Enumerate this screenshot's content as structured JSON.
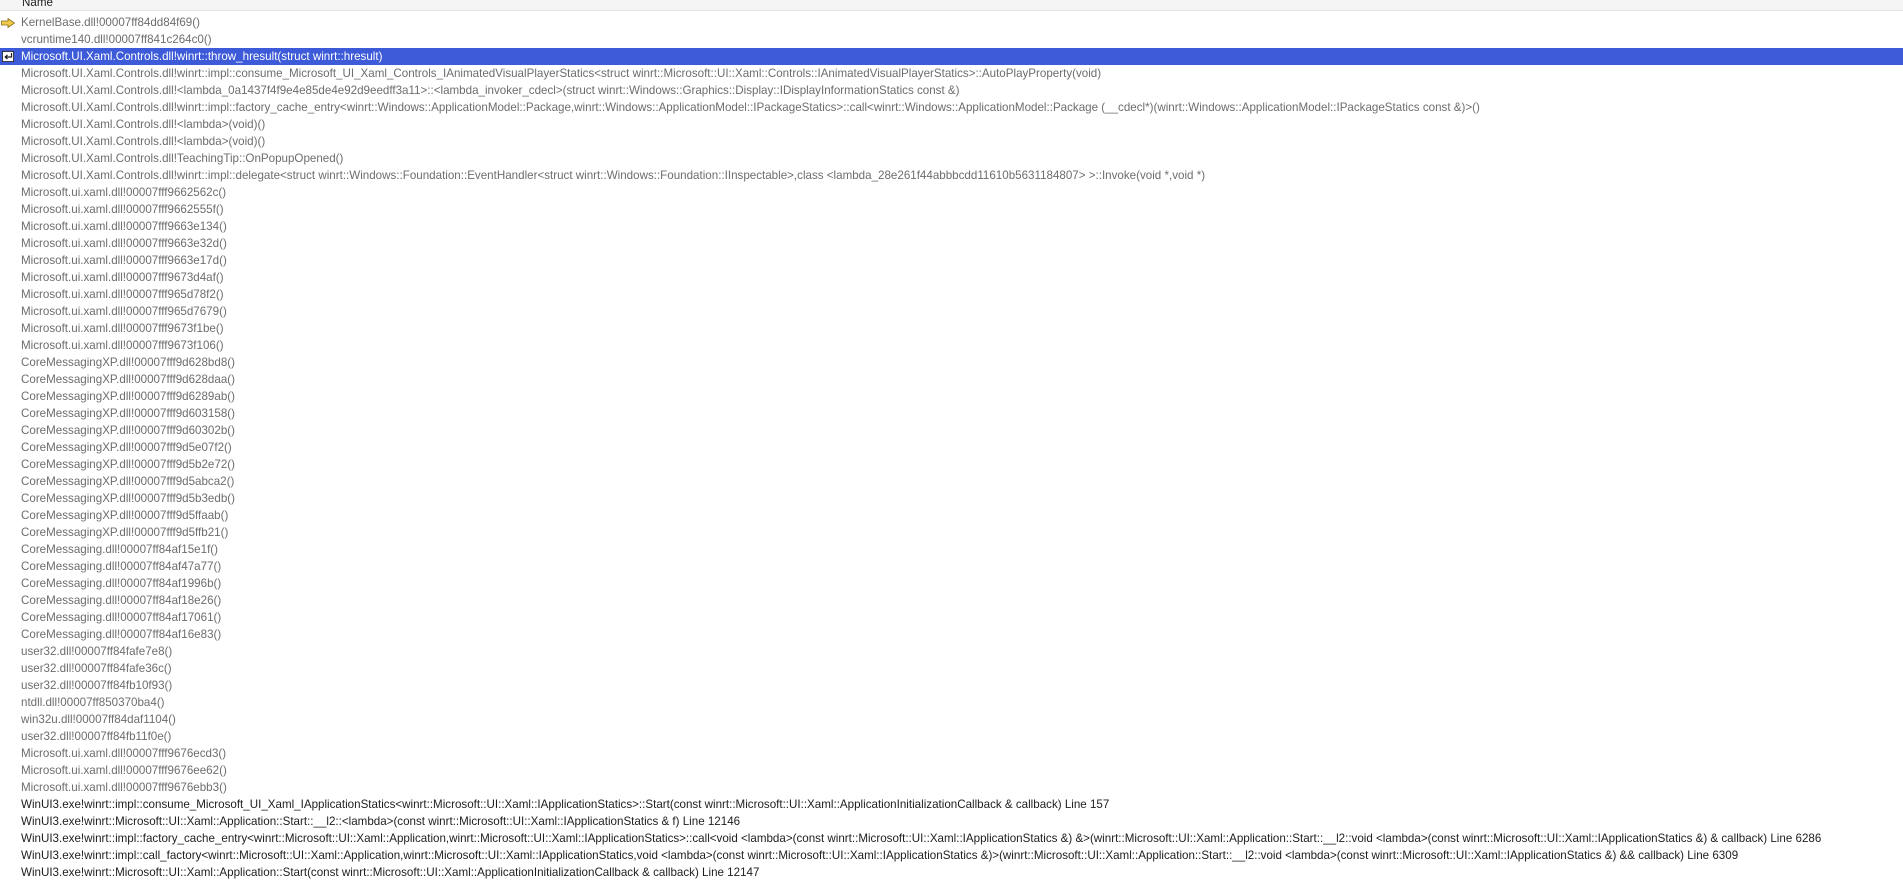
{
  "header": {
    "name_label": "Name"
  },
  "colors": {
    "selection": "#3d5bd8",
    "external_text": "#6d6d6d",
    "user_text": "#1e1e1e",
    "current_arrow": "#f2c94c"
  },
  "rows": [
    {
      "text": "KernelBase.dll!00007ff84dd84f69()",
      "marker": "current-frame-arrow"
    },
    {
      "text": "vcruntime140.dll!00007ff841c264c0()"
    },
    {
      "text": "Microsoft.UI.Xaml.Controls.dll!winrt::throw_hresult(struct winrt::hresult)",
      "marker": "return-arrow",
      "selected": true
    },
    {
      "text": "Microsoft.UI.Xaml.Controls.dll!winrt::impl::consume_Microsoft_UI_Xaml_Controls_IAnimatedVisualPlayerStatics<struct winrt::Microsoft::UI::Xaml::Controls::IAnimatedVisualPlayerStatics>::AutoPlayProperty(void)"
    },
    {
      "text": "Microsoft.UI.Xaml.Controls.dll!<lambda_0a1437f4f9e4e85de4e92d9eedff3a11>::<lambda_invoker_cdecl>(struct winrt::Windows::Graphics::Display::IDisplayInformationStatics const &)"
    },
    {
      "text": "Microsoft.UI.Xaml.Controls.dll!winrt::impl::factory_cache_entry<winrt::Windows::ApplicationModel::Package,winrt::Windows::ApplicationModel::IPackageStatics>::call<winrt::Windows::ApplicationModel::Package (__cdecl*)(winrt::Windows::ApplicationModel::IPackageStatics const &)>()"
    },
    {
      "text": "Microsoft.UI.Xaml.Controls.dll!<lambda>(void)()"
    },
    {
      "text": "Microsoft.UI.Xaml.Controls.dll!<lambda>(void)()"
    },
    {
      "text": "Microsoft.UI.Xaml.Controls.dll!TeachingTip::OnPopupOpened()"
    },
    {
      "text": "Microsoft.UI.Xaml.Controls.dll!winrt::impl::delegate<struct winrt::Windows::Foundation::EventHandler<struct winrt::Windows::Foundation::IInspectable>,class <lambda_28e261f44abbbcdd11610b5631184807> >::Invoke(void *,void *)"
    },
    {
      "text": "Microsoft.ui.xaml.dll!00007fff9662562c()"
    },
    {
      "text": "Microsoft.ui.xaml.dll!00007fff9662555f()"
    },
    {
      "text": "Microsoft.ui.xaml.dll!00007fff9663e134()"
    },
    {
      "text": "Microsoft.ui.xaml.dll!00007fff9663e32d()"
    },
    {
      "text": "Microsoft.ui.xaml.dll!00007fff9663e17d()"
    },
    {
      "text": "Microsoft.ui.xaml.dll!00007fff9673d4af()"
    },
    {
      "text": "Microsoft.ui.xaml.dll!00007fff965d78f2()"
    },
    {
      "text": "Microsoft.ui.xaml.dll!00007fff965d7679()"
    },
    {
      "text": "Microsoft.ui.xaml.dll!00007fff9673f1be()"
    },
    {
      "text": "Microsoft.ui.xaml.dll!00007fff9673f106()"
    },
    {
      "text": "CoreMessagingXP.dll!00007fff9d628bd8()"
    },
    {
      "text": "CoreMessagingXP.dll!00007fff9d628daa()"
    },
    {
      "text": "CoreMessagingXP.dll!00007fff9d6289ab()"
    },
    {
      "text": "CoreMessagingXP.dll!00007fff9d603158()"
    },
    {
      "text": "CoreMessagingXP.dll!00007fff9d60302b()"
    },
    {
      "text": "CoreMessagingXP.dll!00007fff9d5e07f2()"
    },
    {
      "text": "CoreMessagingXP.dll!00007fff9d5b2e72()"
    },
    {
      "text": "CoreMessagingXP.dll!00007fff9d5abca2()"
    },
    {
      "text": "CoreMessagingXP.dll!00007fff9d5b3edb()"
    },
    {
      "text": "CoreMessagingXP.dll!00007fff9d5ffaab()"
    },
    {
      "text": "CoreMessagingXP.dll!00007fff9d5ffb21()"
    },
    {
      "text": "CoreMessaging.dll!00007ff84af15e1f()"
    },
    {
      "text": "CoreMessaging.dll!00007ff84af47a77()"
    },
    {
      "text": "CoreMessaging.dll!00007ff84af1996b()"
    },
    {
      "text": "CoreMessaging.dll!00007ff84af18e26()"
    },
    {
      "text": "CoreMessaging.dll!00007ff84af17061()"
    },
    {
      "text": "CoreMessaging.dll!00007ff84af16e83()"
    },
    {
      "text": "user32.dll!00007ff84fafe7e8()"
    },
    {
      "text": "user32.dll!00007ff84fafe36c()"
    },
    {
      "text": "user32.dll!00007ff84fb10f93()"
    },
    {
      "text": "ntdll.dll!00007ff850370ba4()"
    },
    {
      "text": "win32u.dll!00007ff84daf1104()"
    },
    {
      "text": "user32.dll!00007ff84fb11f0e()"
    },
    {
      "text": "Microsoft.ui.xaml.dll!00007fff9676ecd3()"
    },
    {
      "text": "Microsoft.ui.xaml.dll!00007fff9676ee62()"
    },
    {
      "text": "Microsoft.ui.xaml.dll!00007fff9676ebb3()"
    },
    {
      "text": "WinUI3.exe!winrt::impl::consume_Microsoft_UI_Xaml_IApplicationStatics<winrt::Microsoft::UI::Xaml::IApplicationStatics>::Start(const winrt::Microsoft::UI::Xaml::ApplicationInitializationCallback & callback) Line 157",
      "user": true
    },
    {
      "text": "WinUI3.exe!winrt::Microsoft::UI::Xaml::Application::Start::__l2::<lambda>(const winrt::Microsoft::UI::Xaml::IApplicationStatics & f) Line 12146",
      "user": true
    },
    {
      "text": "WinUI3.exe!winrt::impl::factory_cache_entry<winrt::Microsoft::UI::Xaml::Application,winrt::Microsoft::UI::Xaml::IApplicationStatics>::call<void <lambda>(const winrt::Microsoft::UI::Xaml::IApplicationStatics &) &>(winrt::Microsoft::UI::Xaml::Application::Start::__l2::void <lambda>(const winrt::Microsoft::UI::Xaml::IApplicationStatics &) & callback) Line 6286",
      "user": true
    },
    {
      "text": "WinUI3.exe!winrt::impl::call_factory<winrt::Microsoft::UI::Xaml::Application,winrt::Microsoft::UI::Xaml::IApplicationStatics,void <lambda>(const winrt::Microsoft::UI::Xaml::IApplicationStatics &)>(winrt::Microsoft::UI::Xaml::Application::Start::__l2::void <lambda>(const winrt::Microsoft::UI::Xaml::IApplicationStatics &) && callback) Line 6309",
      "user": true
    },
    {
      "text": "WinUI3.exe!winrt::Microsoft::UI::Xaml::Application::Start(const winrt::Microsoft::UI::Xaml::ApplicationInitializationCallback & callback) Line 12147",
      "user": true
    }
  ]
}
